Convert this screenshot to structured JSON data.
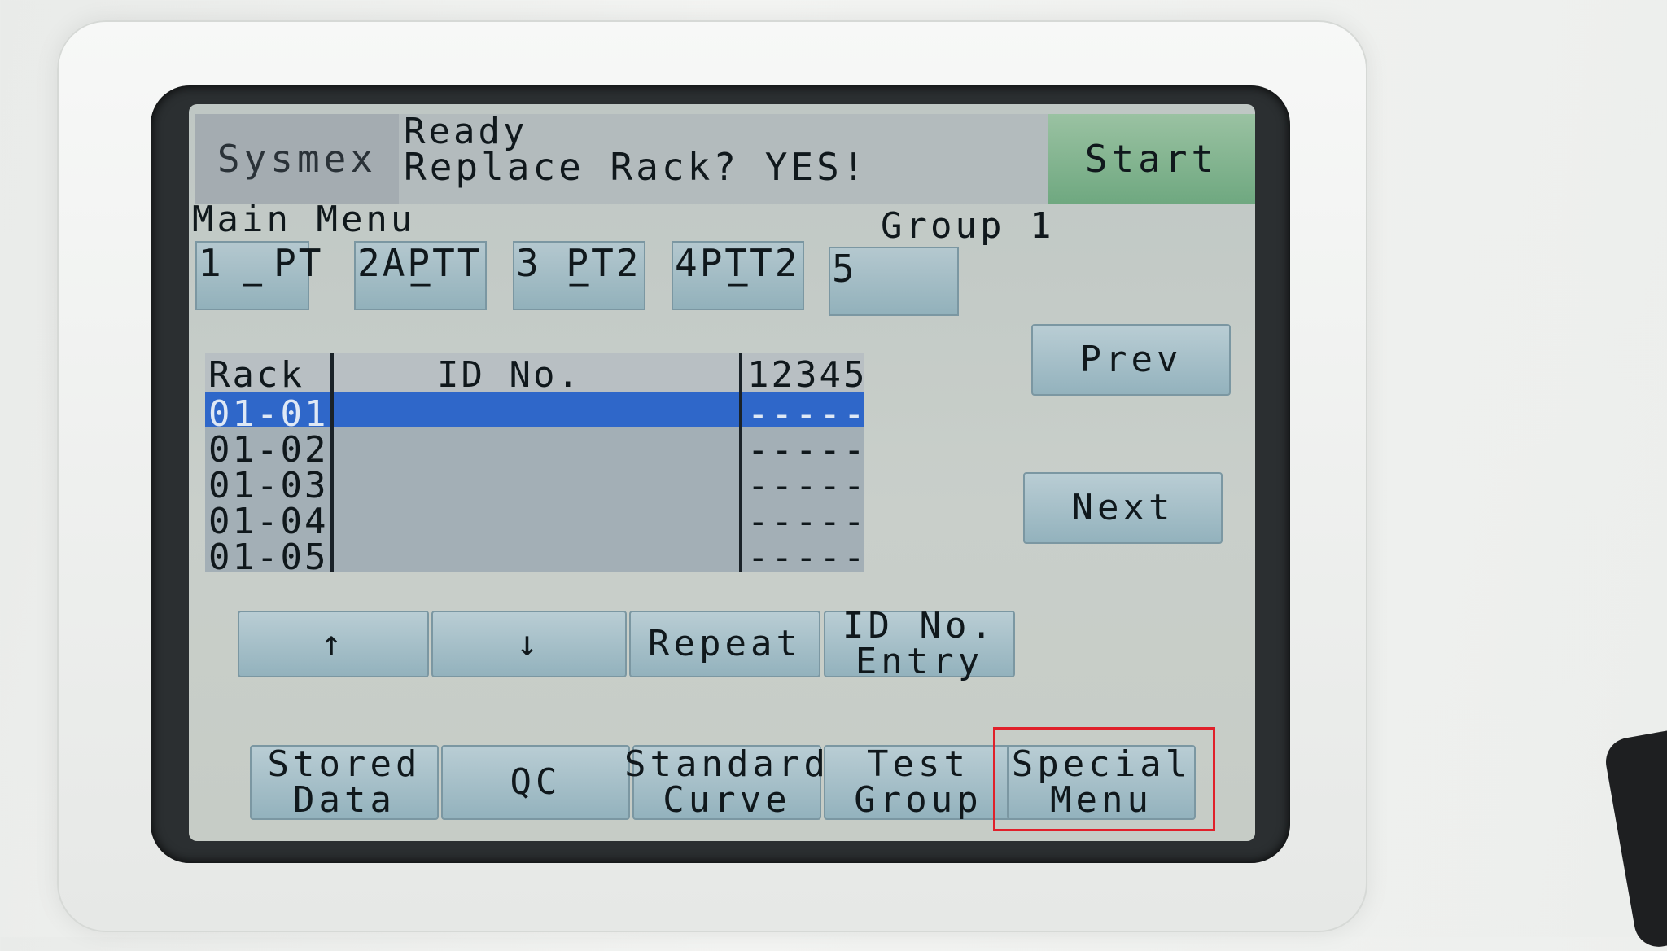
{
  "header": {
    "brand": "Sysmex",
    "status_line1": "Ready",
    "status_line2": "Replace Rack? YES!",
    "start_label": "Start"
  },
  "menu": {
    "title": "Main Menu",
    "group_label": "Group 1",
    "tabs": [
      {
        "label": "1  PT",
        "marker": "—"
      },
      {
        "label": "2APTT",
        "marker": "—"
      },
      {
        "label": "3 PT2",
        "marker": "—"
      },
      {
        "label": "4PTT2",
        "marker": "—"
      },
      {
        "label": "5",
        "marker": ""
      }
    ]
  },
  "table": {
    "headers": {
      "rack": "Rack",
      "id": "ID No.",
      "tests": "12345"
    },
    "rows": [
      {
        "rack": "01-01",
        "id": "",
        "tests": "-----",
        "selected": true
      },
      {
        "rack": "01-02",
        "id": "",
        "tests": "-----",
        "selected": false
      },
      {
        "rack": "01-03",
        "id": "",
        "tests": "-----",
        "selected": false
      },
      {
        "rack": "01-04",
        "id": "",
        "tests": "-----",
        "selected": false
      },
      {
        "rack": "01-05",
        "id": "",
        "tests": "-----",
        "selected": false
      }
    ]
  },
  "nav": {
    "prev_label": "Prev",
    "next_label": "Next"
  },
  "actions": {
    "up_label": "↑",
    "down_label": "↓",
    "repeat_label": "Repeat",
    "id_entry_line1": "ID No.",
    "id_entry_line2": "Entry"
  },
  "bottom_menu": {
    "stored_line1": "Stored",
    "stored_line2": "Data",
    "qc_label": "QC",
    "standard_line1": "Standard",
    "standard_line2": "Curve",
    "test_line1": "Test",
    "test_line2": "Group",
    "special_line1": "Special",
    "special_line2": "Menu"
  },
  "colors": {
    "lcd_background": "#c6ccc6",
    "button_blue": "#93b2bd",
    "start_green": "#6fa880",
    "selected_row": "#2f67c9",
    "highlight_red": "#e0202a"
  }
}
